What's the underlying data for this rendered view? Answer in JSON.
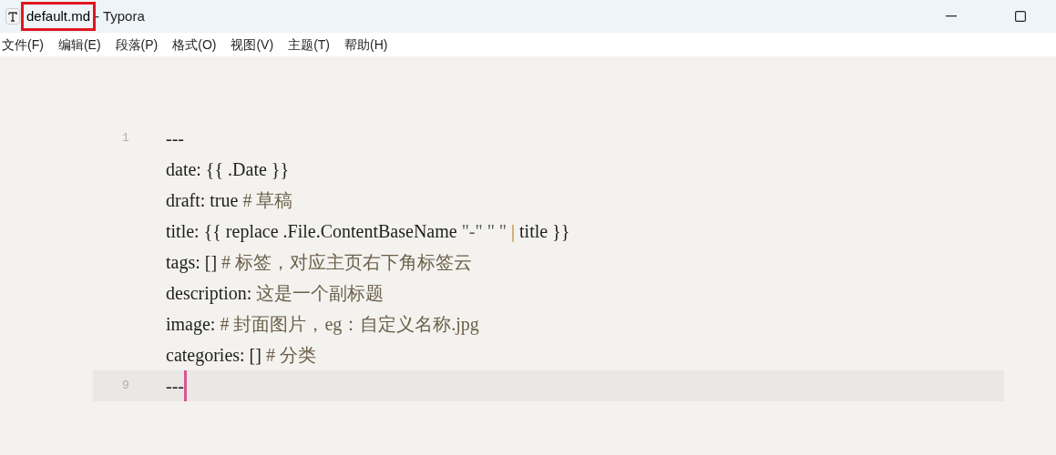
{
  "window": {
    "file_name": "default.md",
    "file_name_highlighted": true,
    "app_suffix": "- Typora"
  },
  "menu": [
    "文件(F)",
    "编辑(E)",
    "段落(P)",
    "格式(O)",
    "视图(V)",
    "主题(T)",
    "帮助(H)"
  ],
  "editor": {
    "lines": [
      {
        "number": "1",
        "active": false,
        "segments": [
          {
            "kind": "text",
            "text": "---"
          }
        ]
      },
      {
        "active": false,
        "segments": [
          {
            "kind": "text",
            "text": "date: {{ .Date }}"
          }
        ]
      },
      {
        "active": false,
        "segments": [
          {
            "kind": "text",
            "text": "draft: true "
          },
          {
            "kind": "comment",
            "text": "# 草稿"
          }
        ]
      },
      {
        "active": false,
        "segments": [
          {
            "kind": "text",
            "text": "title: {{ replace .File.ContentBaseName "
          },
          {
            "kind": "string",
            "text": "\"-\" \" \""
          },
          {
            "kind": "operator",
            "text": " | "
          },
          {
            "kind": "text",
            "text": "title }}"
          }
        ]
      },
      {
        "active": false,
        "segments": [
          {
            "kind": "text",
            "text": "tags: [] "
          },
          {
            "kind": "comment",
            "text": "# 标签，对应主页右下角标签云"
          }
        ]
      },
      {
        "active": false,
        "segments": [
          {
            "kind": "text",
            "text": "description: "
          },
          {
            "kind": "comment",
            "text": "这是一个副标题"
          }
        ]
      },
      {
        "active": false,
        "segments": [
          {
            "kind": "text",
            "text": "image: "
          },
          {
            "kind": "comment",
            "text": "# 封面图片，eg：自定义名称.jpg"
          }
        ]
      },
      {
        "active": false,
        "segments": [
          {
            "kind": "text",
            "text": "categories: [] "
          },
          {
            "kind": "comment",
            "text": "# 分类"
          }
        ]
      },
      {
        "number": "9",
        "active": true,
        "segments": [
          {
            "kind": "text",
            "text": "---"
          }
        ]
      }
    ]
  }
}
